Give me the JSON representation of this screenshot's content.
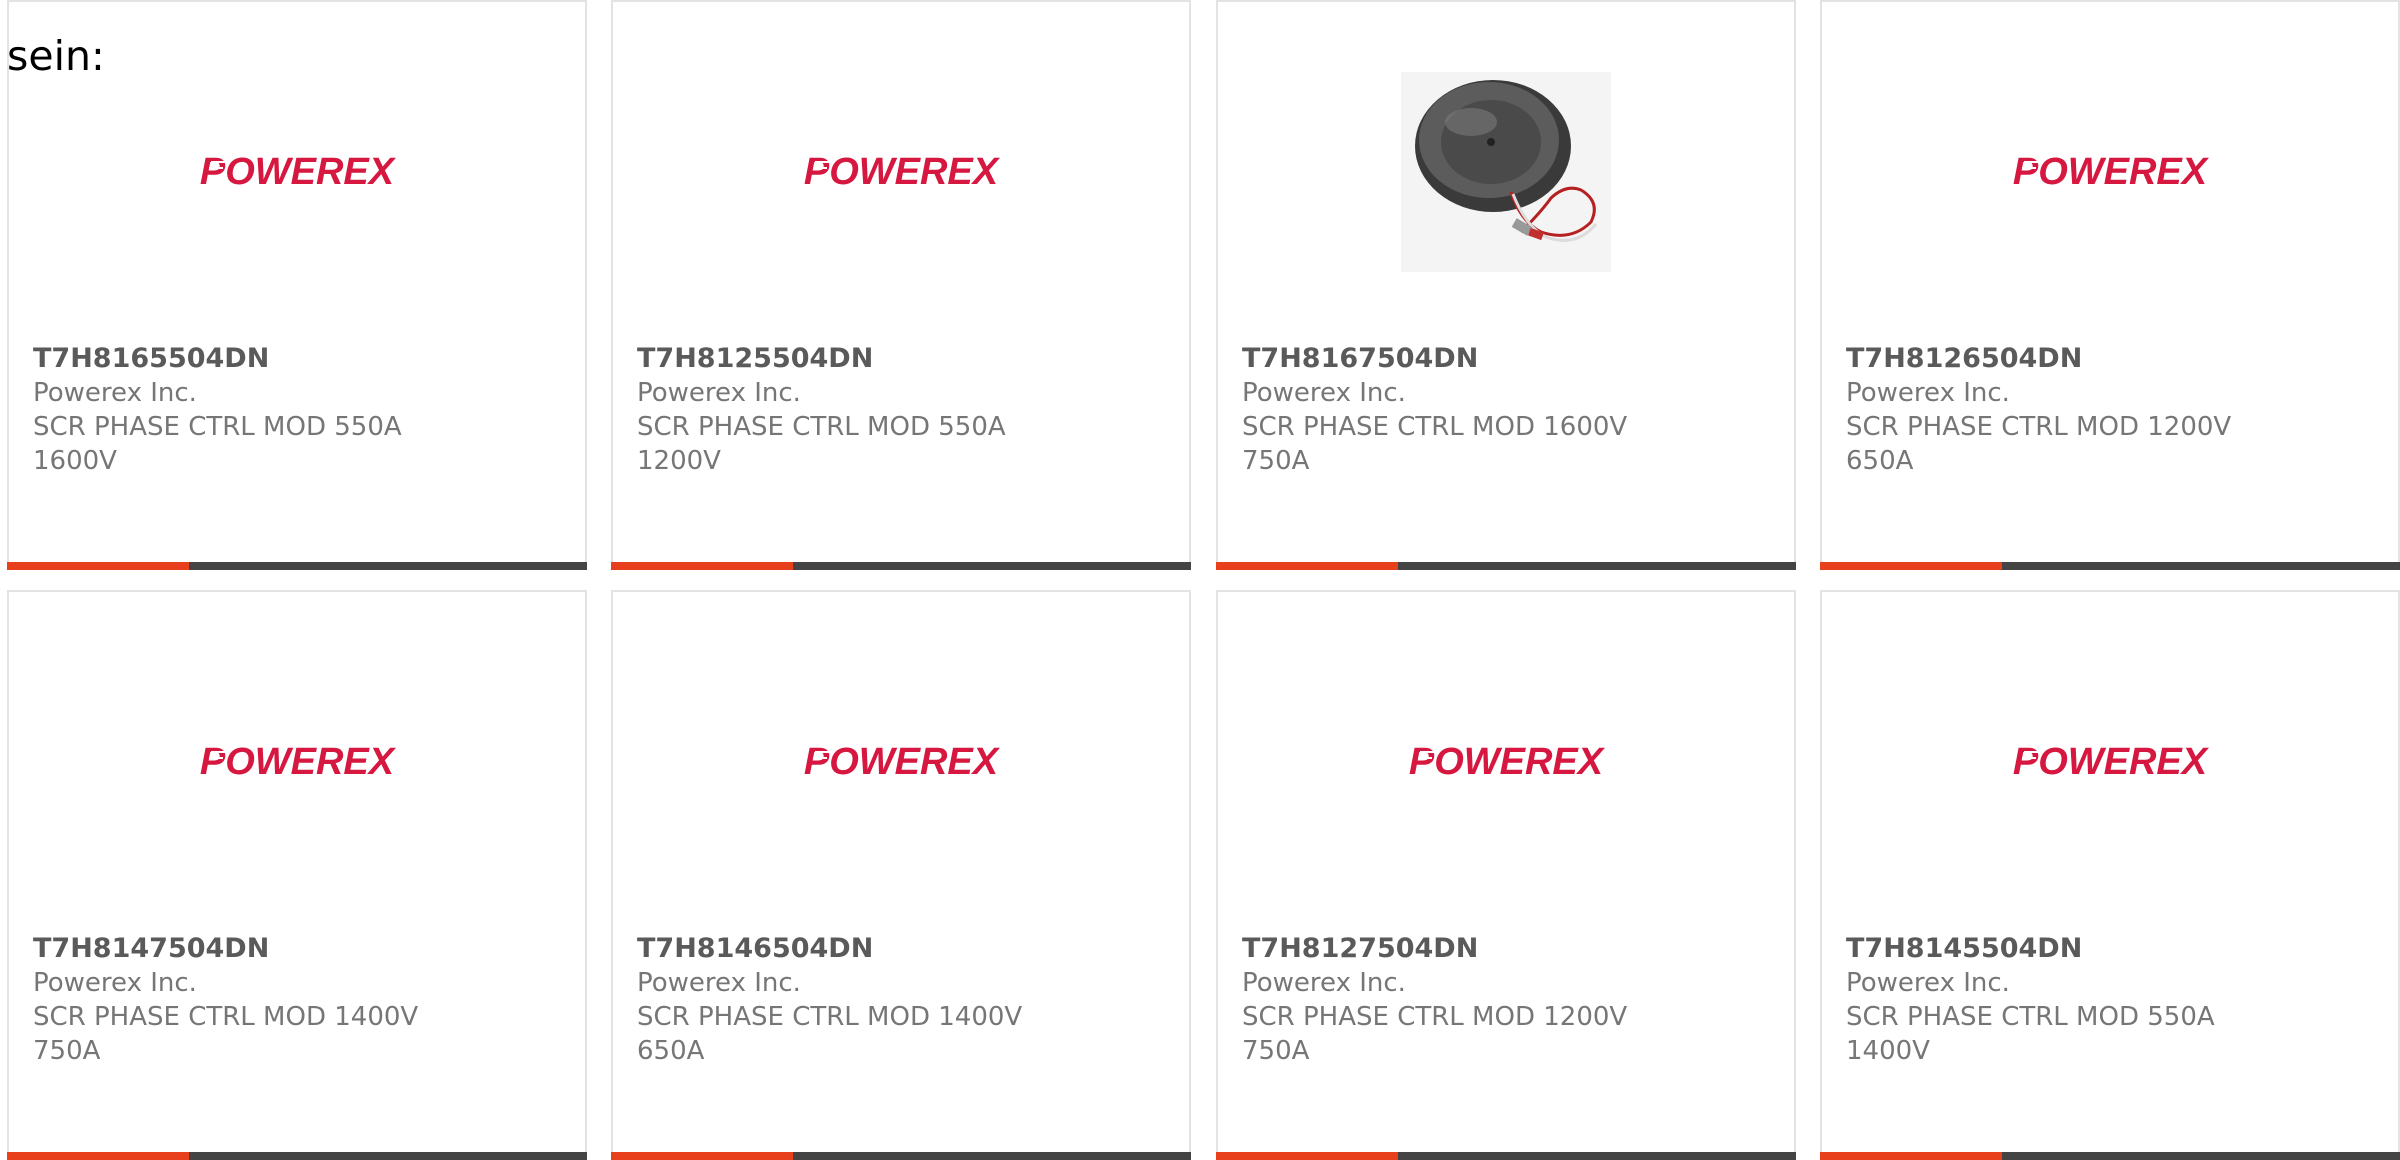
{
  "intro": {
    "text": "sein:"
  },
  "brand": {
    "logo_text": "POWEREX",
    "logo_color": "#d6173f",
    "accent_color": "#e8401c",
    "bar_color": "#444444"
  },
  "products": [
    {
      "part_number": "T7H8165504DN",
      "manufacturer": "Powerex Inc.",
      "description": "SCR PHASE CTRL MOD 550A 1600V",
      "image": "powerex-logo"
    },
    {
      "part_number": "T7H8125504DN",
      "manufacturer": "Powerex Inc.",
      "description": "SCR PHASE CTRL MOD 550A 1200V",
      "image": "powerex-logo"
    },
    {
      "part_number": "T7H8167504DN",
      "manufacturer": "Powerex Inc.",
      "description": "SCR PHASE CTRL MOD 1600V 750A",
      "image": "thyristor-disc-photo"
    },
    {
      "part_number": "T7H8126504DN",
      "manufacturer": "Powerex Inc.",
      "description": "SCR PHASE CTRL MOD 1200V 650A",
      "image": "powerex-logo"
    },
    {
      "part_number": "T7H8147504DN",
      "manufacturer": "Powerex Inc.",
      "description": "SCR PHASE CTRL MOD 1400V 750A",
      "image": "powerex-logo"
    },
    {
      "part_number": "T7H8146504DN",
      "manufacturer": "Powerex Inc.",
      "description": "SCR PHASE CTRL MOD 1400V 650A",
      "image": "powerex-logo"
    },
    {
      "part_number": "T7H8127504DN",
      "manufacturer": "Powerex Inc.",
      "description": "SCR PHASE CTRL MOD 1200V 750A",
      "image": "powerex-logo"
    },
    {
      "part_number": "T7H8145504DN",
      "manufacturer": "Powerex Inc.",
      "description": "SCR PHASE CTRL MOD 550A 1400V",
      "image": "powerex-logo"
    }
  ]
}
